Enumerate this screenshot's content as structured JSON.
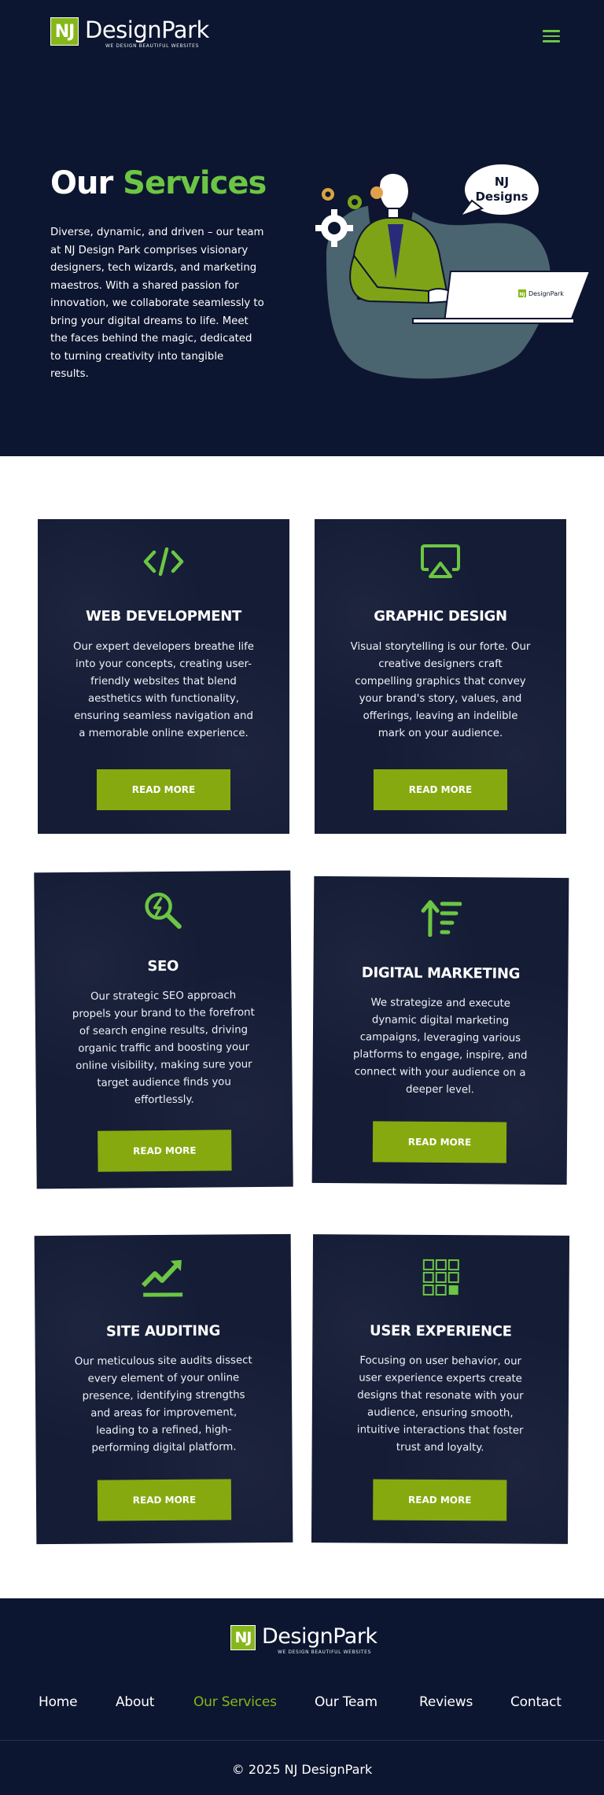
{
  "brand": {
    "logo_mark": "NJ",
    "name": "DesignPark",
    "tagline": "WE DESIGN BEAUTIFUL WEBSITES",
    "accent_color": "#6cc644",
    "button_color": "#86a90f",
    "navy_color": "#0d1630"
  },
  "header": {
    "menu_icon": "hamburger-icon"
  },
  "hero": {
    "title_part1": "Our",
    "title_part2": "Services",
    "description": "Diverse, dynamic, and driven – our team at NJ Design Park comprises visionary designers, tech wizards, and marketing maestros. With a shared passion for innovation, we collaborate seamlessly to bring your digital dreams to life. Meet the faces behind the magic, dedicated to turning creativity into tangible results.",
    "illustration": {
      "bubble_line1": "NJ",
      "bubble_line2": "Designs",
      "laptop_logo_mark": "NJ",
      "laptop_logo_text": "DesignPark"
    }
  },
  "services": [
    {
      "icon": "code-icon",
      "title": "WEB DEVELOPMENT",
      "text": "Our expert developers breathe life into your concepts, creating user-friendly websites that blend aesthetics with functionality, ensuring seamless navigation and a memorable online experience.",
      "button": "READ MORE"
    },
    {
      "icon": "airplay-icon",
      "title": "GRAPHIC DESIGN",
      "text": "Visual storytelling is our forte. Our creative designers craft compelling graphics that convey your brand's story, values, and offerings, leaving an indelible mark on your audience.",
      "button": "READ MORE"
    },
    {
      "icon": "seo-search-icon",
      "title": "SEO",
      "text": "Our strategic SEO approach propels your brand to the forefront of search engine results, driving organic traffic and boosting your online visibility, making sure your target audience finds you effortlessly.",
      "button": "READ MORE"
    },
    {
      "icon": "sort-up-icon",
      "title": "DIGITAL MARKETING",
      "text": "We strategize and execute dynamic digital marketing campaigns, leveraging various platforms to engage, inspire, and connect with your audience on a deeper level.",
      "button": "READ MORE"
    },
    {
      "icon": "trend-line-icon",
      "title": "SITE AUDITING",
      "text": "Our meticulous site audits dissect every element of your online presence, identifying strengths and areas for improvement, leading to a refined, high-performing digital platform.",
      "button": "READ MORE"
    },
    {
      "icon": "grid-icon",
      "title": "USER EXPERIENCE",
      "text": "Focusing on user behavior, our user experience experts create designs that resonate with your audience, ensuring smooth, intuitive interactions that foster trust and loyalty.",
      "button": "READ MORE"
    }
  ],
  "footer": {
    "nav": [
      "Home",
      "About",
      "Our Services",
      "Our Team",
      "Reviews",
      "Contact"
    ],
    "active_nav": "Our Services",
    "copyright": "© 2025 NJ DesignPark"
  }
}
